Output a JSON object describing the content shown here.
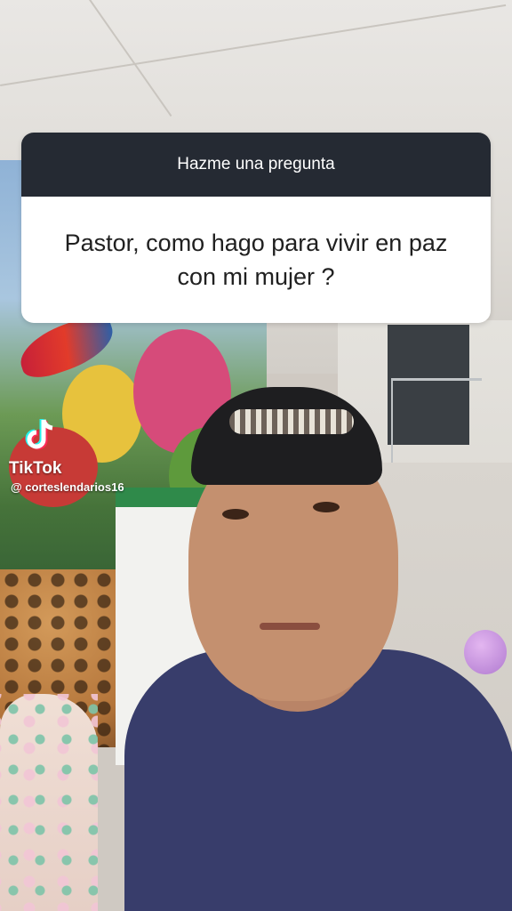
{
  "question_sticker": {
    "header": "Hazme una pregunta",
    "line1": "Pastor, como hago para vivir en paz",
    "line2": "con mi mujer ?"
  },
  "watermark": {
    "brand": "TikTok",
    "username": "@ corteslendarios16",
    "icon": "tiktok-logo-icon"
  },
  "colors": {
    "sticker_header_bg": "#252a33",
    "sticker_body_bg": "#ffffff",
    "shirt": "#383d6b"
  }
}
